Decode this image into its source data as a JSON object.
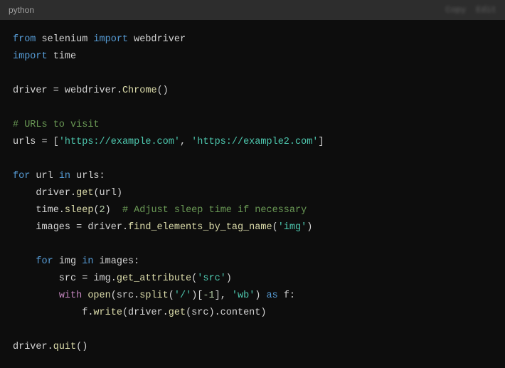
{
  "header": {
    "language": "python",
    "btn1": "Copy",
    "btn2": "Edit"
  },
  "code": {
    "l1": {
      "t1": "from",
      "t2": " selenium ",
      "t3": "import",
      "t4": " webdriver"
    },
    "l2": {
      "t1": "import",
      "t2": " time"
    },
    "l3": "",
    "l4": {
      "t1": "driver ",
      "t2": "=",
      "t3": " webdriver",
      "t4": ".",
      "t5": "Chrome",
      "t6": "()"
    },
    "l5": "",
    "l6": {
      "t1": "# URLs to visit"
    },
    "l7": {
      "t1": "urls ",
      "t2": "=",
      "t3": " [",
      "t4": "'https://example.com'",
      "t5": ", ",
      "t6": "'https://example2.com'",
      "t7": "]"
    },
    "l8": "",
    "l9": {
      "t1": "for",
      "t2": " url ",
      "t3": "in",
      "t4": " urls:"
    },
    "l10": {
      "t1": "    driver.",
      "t2": "get",
      "t3": "(url)"
    },
    "l11": {
      "t1": "    time.",
      "t2": "sleep",
      "t3": "(",
      "t4": "2",
      "t5": ")  ",
      "t6": "# Adjust sleep time if necessary"
    },
    "l12": {
      "t1": "    images ",
      "t2": "=",
      "t3": " driver.",
      "t4": "find_elements_by_tag_name",
      "t5": "(",
      "t6": "'img'",
      "t7": ")"
    },
    "l13": "",
    "l14": {
      "t1": "    ",
      "t2": "for",
      "t3": " img ",
      "t4": "in",
      "t5": " images:"
    },
    "l15": {
      "t1": "        src ",
      "t2": "=",
      "t3": " img.",
      "t4": "get_attribute",
      "t5": "(",
      "t6": "'src'",
      "t7": ")"
    },
    "l16": {
      "t1": "        ",
      "t2": "with",
      "t3": " ",
      "t4": "open",
      "t5": "(src.",
      "t6": "split",
      "t7": "(",
      "t8": "'/'",
      "t9": ")[",
      "t10": "-1",
      "t11": "], ",
      "t12": "'wb'",
      "t13": ") ",
      "t14": "as",
      "t15": " f:"
    },
    "l17": {
      "t1": "            f.",
      "t2": "write",
      "t3": "(driver.",
      "t4": "get",
      "t5": "(src).content)"
    },
    "l18": "",
    "l19": {
      "t1": "driver.",
      "t2": "quit",
      "t3": "()"
    }
  }
}
